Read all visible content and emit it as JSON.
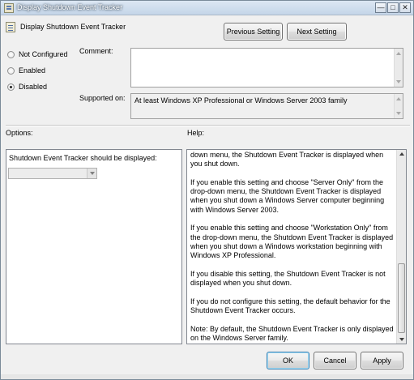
{
  "window": {
    "title": "Display Shutdown Event Tracker",
    "controls": {
      "minimize": "—",
      "maximize": "□",
      "close": "✕"
    }
  },
  "header": {
    "policy_title": "Display Shutdown Event Tracker",
    "prev_label": "Previous Setting",
    "next_label": "Next Setting"
  },
  "state": {
    "options": [
      {
        "label": "Not Configured",
        "checked": false
      },
      {
        "label": "Enabled",
        "checked": false
      },
      {
        "label": "Disabled",
        "checked": true
      }
    ]
  },
  "comment": {
    "label": "Comment:",
    "value": ""
  },
  "supported": {
    "label": "Supported on:",
    "value": "At least Windows XP Professional or Windows Server 2003 family"
  },
  "options_panel": {
    "heading": "Options:",
    "field_label": "Shutdown Event Tracker should be displayed:",
    "selected_value": ""
  },
  "help_panel": {
    "heading": "Help:",
    "paragraphs": [
      "down menu, the Shutdown Event Tracker is displayed when you shut down.",
      "If you enable this setting and choose \"Server Only\" from the drop-down menu, the Shutdown Event Tracker is displayed when you shut down a Windows Server computer beginning with Windows Server 2003.",
      "If you enable this setting and choose \"Workstation Only\" from the drop-down menu, the Shutdown Event Tracker is displayed when you shut down a Windows workstation beginning with Windows XP Professional.",
      "If you disable this setting, the Shutdown Event Tracker is not displayed when you shut down.",
      "If you do not configure this setting, the default behavior for the Shutdown Event Tracker occurs.",
      "Note: By default, the Shutdown Event Tracker is only displayed on the Windows Server family."
    ]
  },
  "footer": {
    "ok_label": "OK",
    "cancel_label": "Cancel",
    "apply_label": "Apply"
  },
  "colors": {
    "title_bar": "#c4d5e8",
    "dialog_bg": "#f0f0f0",
    "ok_focus_border": "#3c7fb1"
  }
}
